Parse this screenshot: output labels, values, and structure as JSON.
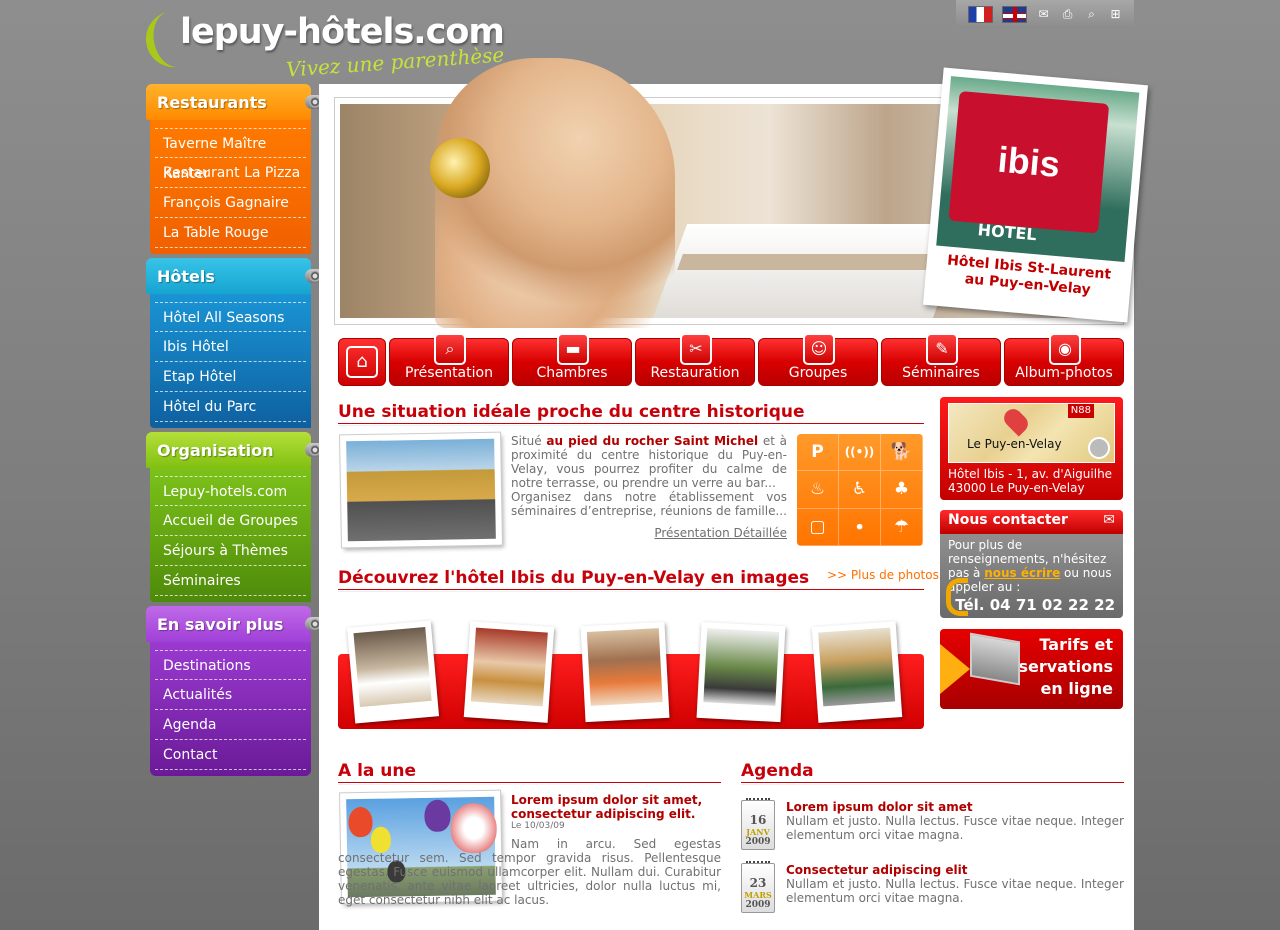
{
  "header": {
    "logo_name": "lepuy-hôtels.com",
    "logo_tagline": "Vivez une parenthèse",
    "toolbar": {
      "icons": [
        "flag-fr-icon",
        "flag-en-icon",
        "mail-icon",
        "print-icon",
        "search-icon",
        "sitemap-icon"
      ]
    }
  },
  "sidebar": {
    "sections": [
      {
        "title": "Restaurants",
        "color": "#ff7a00",
        "items": [
          "Taverne Maître Kanter",
          "Restaurant La Pizza",
          "François Gagnaire",
          "La Table Rouge"
        ]
      },
      {
        "title": "Hôtels",
        "color": "#1a94d4",
        "items": [
          "Hôtel All Seasons",
          "Ibis Hôtel",
          "Etap Hôtel",
          "Hôtel du Parc"
        ]
      },
      {
        "title": "Organisation",
        "color": "#7cc21a",
        "items": [
          "Lepuy-hotels.com",
          "Accueil de Groupes",
          "Séjours à Thèmes",
          "Séminaires"
        ]
      },
      {
        "title": "En savoir plus",
        "color": "#9a3ad0",
        "items": [
          "Destinations",
          "Actualités",
          "Agenda",
          "Contact"
        ]
      }
    ]
  },
  "banner": {
    "sign_text": "ibis",
    "sign_sub": "HOTEL",
    "caption_line1": "Hôtel Ibis St-Laurent",
    "caption_line2": "au Puy-en-Velay"
  },
  "nav": {
    "home_icon": "home-icon",
    "items": [
      {
        "label": "Présentation",
        "icon": "magnifier-icon"
      },
      {
        "label": "Chambres",
        "icon": "bed-icon"
      },
      {
        "label": "Restauration",
        "icon": "cutlery-icon"
      },
      {
        "label": "Groupes",
        "icon": "group-icon"
      },
      {
        "label": "Séminaires",
        "icon": "pencil-icon"
      },
      {
        "label": "Album-photos",
        "icon": "camera-icon"
      }
    ]
  },
  "situation": {
    "title": "Une situation idéale proche du centre historique",
    "text_before": "Situé ",
    "text_bold": "au pied du rocher Saint Michel",
    "text_after": " et à proximité du centre historique du Puy-en-Velay, vous pourrez profiter du calme de notre terrasse, ou prendre un verre au bar...",
    "text_2": "Organisez dans notre établissement vos séminaires d’entreprise, réunions de famille...",
    "more_link": "Présentation Détaillée",
    "amenities": [
      {
        "icon": "parking-icon",
        "glyph": "P"
      },
      {
        "icon": "wifi-icon",
        "glyph": "((•))"
      },
      {
        "icon": "pets-icon",
        "glyph": "🐕"
      },
      {
        "icon": "pool-icon",
        "glyph": "♨"
      },
      {
        "icon": "wheelchair-icon",
        "glyph": "♿"
      },
      {
        "icon": "tree-icon",
        "glyph": "♣"
      },
      {
        "icon": "tv-icon",
        "glyph": "▢"
      },
      {
        "icon": "restaurant-icon",
        "glyph": "⚫"
      },
      {
        "icon": "terrace-icon",
        "glyph": "☂"
      }
    ]
  },
  "gallery": {
    "title": "Découvrez l'hôtel Ibis du Puy-en-Velay en images",
    "more_link": ">> Plus de photos"
  },
  "map": {
    "label": "Le Puy-en-Velay",
    "road": "N88",
    "address_line1": "Hôtel Ibis - 1, av. d'Aiguilhe",
    "address_line2": "43000 Le Puy-en-Velay"
  },
  "contact": {
    "title": "Nous contacter",
    "text_before": "Pour plus de renseignements, n'hésitez pas à ",
    "link": "nous écrire",
    "text_after": " ou nous appeler au :",
    "phone": "Tél. 04 71 02 22 22"
  },
  "tarifs": {
    "line1": "Tarifs et",
    "line2": "Réservations",
    "line3": "en ligne"
  },
  "news": {
    "title": "A la une",
    "headline": "Lorem ipsum dolor sit amet, consectetur adipiscing elit.",
    "date": "Le 10/03/09",
    "text": "Nam in arcu. Sed egestas consectetur sem. Sed tempor gravida risus. Pellentesque egestas. Fusce euismod ullamcorper elit. Nullam dui. Curabitur venenatis, ante vitae laoreet ultricies, dolor nulla luctus mi, eget consectetur nibh elit ac lacus."
  },
  "agenda": {
    "title": "Agenda",
    "items": [
      {
        "day": "16",
        "month": "JANV",
        "year": "2009",
        "title": "Lorem ipsum dolor sit amet",
        "text": "Nullam et justo. Nulla lectus. Fusce vitae neque. Integer elementum orci vitae magna."
      },
      {
        "day": "23",
        "month": "MARS",
        "year": "2009",
        "title": "Consectetur adipiscing elit",
        "text": "Nullam et justo. Nulla lectus. Fusce vitae neque. Integer elementum orci vitae magna."
      }
    ]
  }
}
